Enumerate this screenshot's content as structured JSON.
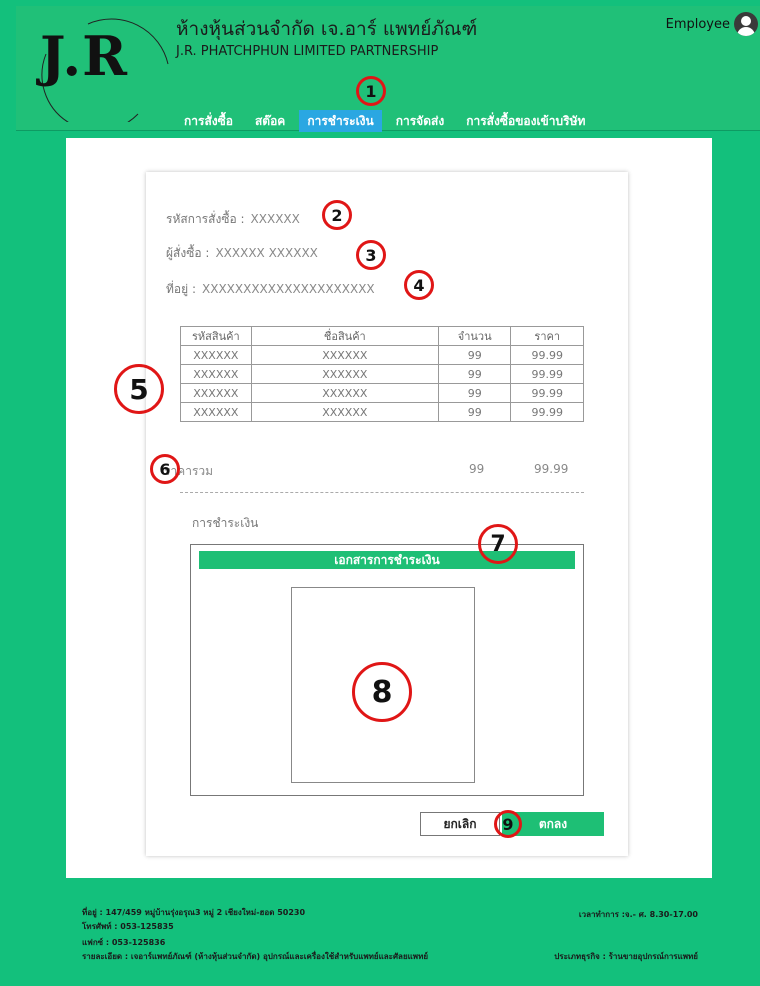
{
  "header": {
    "logo_text": "J.R",
    "logo_ring_text": "J.R. PHATCHPHUN LIMITED PARTNERSHIP",
    "company_th": "ห้างหุ้นส่วนจำกัด เจ.อาร์ แพทย์ภัณฑ์",
    "company_en": "J.R. PHATCHPHUN LIMITED PARTNERSHIP",
    "user_label": "Employee",
    "user_icon": "user-avatar-icon"
  },
  "nav": {
    "items": [
      {
        "label": "การสั่งซื้อ"
      },
      {
        "label": "สต๊อค"
      },
      {
        "label": "การชำระเงิน"
      },
      {
        "label": "การจัดส่ง"
      },
      {
        "label": "การสั่งซื้อของเข้าบริษัท"
      }
    ],
    "active_index": 2
  },
  "markers": [
    "1",
    "2",
    "3",
    "4",
    "5",
    "6",
    "7",
    "8",
    "9"
  ],
  "order": {
    "id_label": "รหัสการสั่งซื้อ :",
    "id_value": "XXXXXX",
    "buyer_label": "ผู้สั่งซื้อ :",
    "buyer_value": "XXXXXX  XXXXXX",
    "address_label": "ที่อยู่ :",
    "address_value": "XXXXXXXXXXXXXXXXXXXXX"
  },
  "table": {
    "headers": [
      "รหัสสินค้า",
      "ชื่อสินค้า",
      "จำนวน",
      "ราคา"
    ],
    "rows": [
      [
        "XXXXXX",
        "XXXXXX",
        "99",
        "99.99"
      ],
      [
        "XXXXXX",
        "XXXXXX",
        "99",
        "99.99"
      ],
      [
        "XXXXXX",
        "XXXXXX",
        "99",
        "99.99"
      ],
      [
        "XXXXXX",
        "XXXXXX",
        "99",
        "99.99"
      ]
    ]
  },
  "total": {
    "label": "ราคารวม",
    "qty": "99",
    "price": "99.99"
  },
  "payment": {
    "section_label": "การชำระเงิน",
    "doc_header": "เอกสารการชำระเงิน"
  },
  "buttons": {
    "cancel": "ยกเลิก",
    "ok": "ตกลง"
  },
  "footer": {
    "address": "ที่อยู่ : 147/459 หมู่บ้านรุ่งอรุณ3 หมู่ 2 เชียงใหม่-ฮอด 50230",
    "phone": "โทรศัพท์ : 053-125835",
    "fax": "แฟกซ์ : 053-125836",
    "details": "รายละเอียด : เจอาร์แพทย์ภัณฑ์ (ห้างหุ้นส่วนจำกัด) อุปกรณ์และเครื่องใช้สำหรับแพทย์และศัลยแพทย์",
    "hours": "เวลาทำการ :จ.- ศ. 8.30-17.00",
    "business_type": "ประเภทธุรกิจ : ร้านขายอุปกรณ์การแพทย์"
  },
  "colors": {
    "brand_green": "#13c07c",
    "active_tab": "#2aa7e2",
    "marker_red": "#e01616"
  }
}
